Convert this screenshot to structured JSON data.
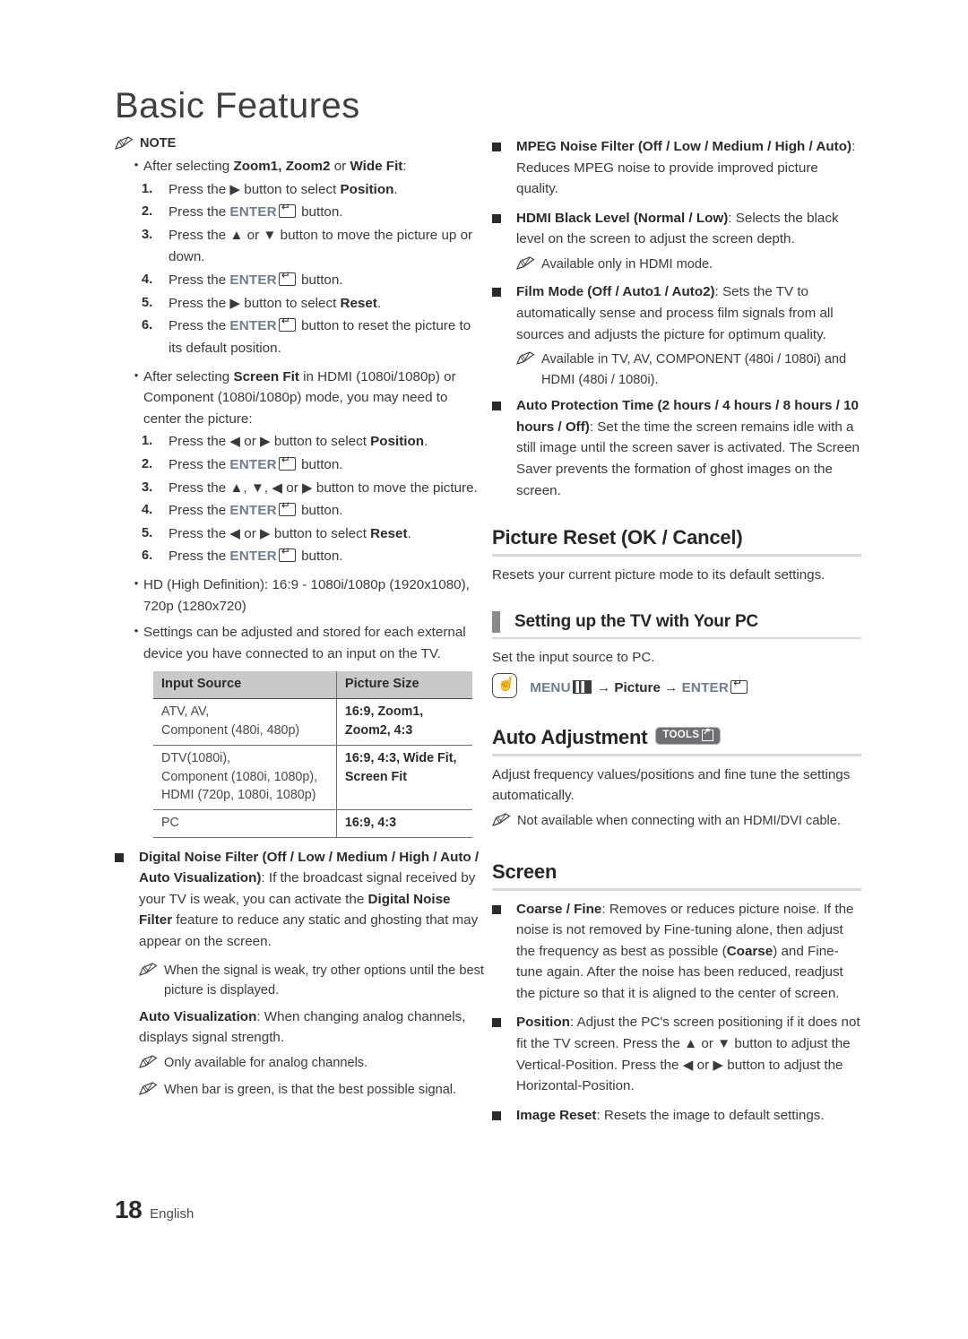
{
  "page": {
    "chapter_title": "Basic Features",
    "page_number": "18",
    "language": "English"
  },
  "left_column": {
    "note_label": "NOTE",
    "note_items": [
      {
        "bullet": "After selecting Zoom1, Zoom2 or Wide Fit:",
        "bullet_bold": [
          "Zoom1, Zoom2",
          "Wide Fit"
        ],
        "steps": [
          {
            "n": "1.",
            "text": "Press the ▶ button to select Position."
          },
          {
            "n": "2.",
            "text": "Press the ENTER↵ button."
          },
          {
            "n": "3.",
            "text": "Press the ▲ or ▼ button to move the picture up or down."
          },
          {
            "n": "4.",
            "text": "Press the ENTER↵ button."
          },
          {
            "n": "5.",
            "text": "Press the ▶ button to select Reset."
          },
          {
            "n": "6.",
            "text": "Press the ENTER↵ button to reset the picture to its default position."
          }
        ]
      },
      {
        "bullet": "After selecting Screen Fit in HDMI (1080i/1080p) or Component (1080i/1080p) mode, you may need to center the picture:",
        "steps": [
          {
            "n": "1.",
            "text": "Press the ◀ or ▶ button to select Position."
          },
          {
            "n": "2.",
            "text": "Press the ENTER↵ button."
          },
          {
            "n": "3.",
            "text": "Press the ▲, ▼, ◀ or ▶ button to move the picture."
          },
          {
            "n": "4.",
            "text": "Press the ENTER↵ button."
          },
          {
            "n": "5.",
            "text": "Press the ◀ or ▶ button to select Reset."
          },
          {
            "n": "6.",
            "text": "Press the ENTER↵ button."
          }
        ]
      }
    ],
    "bullet_hd": "HD (High Definition): 16:9 - 1080i/1080p (1920x1080), 720p (1280x720)",
    "bullet_settings": "Settings can be adjusted and stored for each external device you have connected to an input on the TV.",
    "table": {
      "headers": [
        "Input Source",
        "Picture Size"
      ],
      "rows": [
        {
          "source": "ATV, AV,\nComponent (480i, 480p)",
          "size": "16:9, Zoom1,\nZoom2, 4:3"
        },
        {
          "source": "DTV(1080i),\nComponent (1080i, 1080p),\nHDMI (720p, 1080i, 1080p)",
          "size": "16:9, 4:3, Wide Fit,\nScreen Fit"
        },
        {
          "source": "PC",
          "size": "16:9, 4:3"
        }
      ]
    },
    "digital_noise_filter": {
      "term": "Digital Noise Filter (Off / Low / Medium / High / Auto / Auto Visualization)",
      "desc": ": If the broadcast signal received by your TV is weak, you can activate the Digital Noise Filter feature to reduce any static and ghosting that may appear on the screen.",
      "note": "When the signal is weak, try other options until the best picture is displayed."
    },
    "auto_visualization": {
      "term": "Auto Visualization",
      "desc": ": When changing analog channels, displays signal strength.",
      "note1": "Only available for analog channels.",
      "note2": "When bar is green, is that the best possible signal."
    }
  },
  "right_column": {
    "mpeg_noise_filter": {
      "term": "MPEG Noise Filter (Off / Low / Medium / High / Auto)",
      "desc": ": Reduces MPEG noise to provide improved picture quality."
    },
    "hdmi_black_level": {
      "term": "HDMI Black Level (Normal / Low)",
      "desc": ": Selects the black level on the screen to adjust the screen depth.",
      "note": "Available only in HDMI mode."
    },
    "film_mode": {
      "term": "Film Mode (Off / Auto1 / Auto2)",
      "desc": ": Sets the TV to automatically sense and process film signals from all sources and adjusts the picture for optimum quality.",
      "note": "Available in TV, AV, COMPONENT (480i / 1080i) and HDMI (480i / 1080i)."
    },
    "auto_protection_time": {
      "term": "Auto Protection Time (2 hours / 4 hours / 8 hours / 10 hours / Off)",
      "desc": ": Set the time the screen remains idle with a still image until the screen saver is activated. The Screen Saver prevents the formation of ghost images on the screen."
    },
    "picture_reset": {
      "heading": "Picture Reset (OK / Cancel)",
      "body": "Resets your current picture mode to its default settings."
    },
    "setting_up_pc": {
      "heading": "Setting up the TV with Your PC",
      "body": "Set the input source to PC.",
      "menu_path": {
        "menu_label": "MENU",
        "arrow": "→",
        "picture_label": "Picture",
        "enter_label": "ENTER"
      }
    },
    "auto_adjustment": {
      "heading": "Auto Adjustment",
      "badge": "TOOLS",
      "body": "Adjust frequency values/positions and fine tune the settings automatically.",
      "note": "Not available when connecting with an HDMI/DVI cable."
    },
    "screen": {
      "heading": "Screen",
      "coarse_fine": {
        "term": "Coarse / Fine",
        "desc": ": Removes or reduces picture noise. If the noise is not removed by Fine-tuning alone, then adjust the frequency as best as possible (Coarse) and Fine-tune again. After the noise has been reduced, readjust the picture so that it is aligned to the center of screen."
      },
      "position": {
        "term": "Position",
        "desc": ": Adjust the PC's screen positioning if it does not fit the TV screen. Press the ▲ or ▼ button to adjust the Vertical-Position. Press the ◀ or ▶ button to adjust the Horizontal-Position."
      },
      "image_reset": {
        "term": "Image Reset",
        "desc": ": Resets the image to default settings."
      }
    }
  },
  "colors": {
    "text": "#3a3a3c",
    "bold_text": "#2b2b2d",
    "keyword_blue_gray": "#6f7d92",
    "table_header_bg": "#c9c9c9",
    "rule_gray": "#d8d8d8",
    "badge_bg": "#6f6f73",
    "bar_mark": "#8a8a8c"
  }
}
